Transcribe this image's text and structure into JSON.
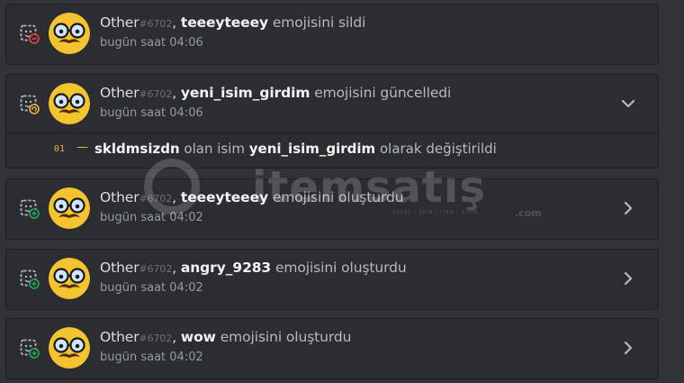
{
  "entries": [
    {
      "user": "Other",
      "discriminator": "#6702",
      "target": "teeeyteeey",
      "action": "emojisini sildi",
      "time": "bugün saat 04:06",
      "icon": "emoji-delete-icon",
      "badge_color": "#f23f43",
      "chevron": "none"
    },
    {
      "user": "Other",
      "discriminator": "#6702",
      "target": "yeni_isim_girdim",
      "action": "emojisini güncelledi",
      "time": "bugün saat 04:06",
      "icon": "emoji-update-icon",
      "badge_color": "#f0b232",
      "chevron": "down",
      "change": {
        "num": "01",
        "dash": "—",
        "old": "skldmsizdn",
        "mid": "olan isim",
        "new": "yeni_isim_girdim",
        "end": "olarak değiştirildi"
      }
    },
    {
      "user": "Other",
      "discriminator": "#6702",
      "target": "teeeyteeey",
      "action": "emojisini oluşturdu",
      "time": "bugün saat 04:02",
      "icon": "emoji-create-icon",
      "badge_color": "#23a55a",
      "chevron": "right"
    },
    {
      "user": "Other",
      "discriminator": "#6702",
      "target": "angry_9283",
      "action": "emojisini oluşturdu",
      "time": "bugün saat 04:02",
      "icon": "emoji-create-icon",
      "badge_color": "#23a55a",
      "chevron": "right"
    },
    {
      "user": "Other",
      "discriminator": "#6702",
      "target": "wow",
      "action": "emojisini oluşturdu",
      "time": "bugün saat 04:02",
      "icon": "emoji-create-icon",
      "badge_color": "#23a55a",
      "chevron": "right"
    }
  ],
  "watermark": {
    "text": "itemsatış",
    "suffix": ".com",
    "tagline": "HESAP / SKIN / ITEM / E-PIN"
  }
}
